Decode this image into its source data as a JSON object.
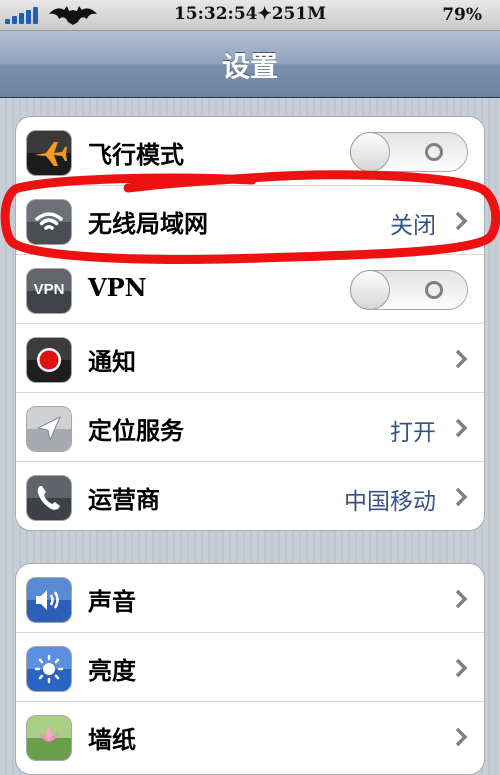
{
  "status_bar": {
    "time": "15:32:54✦251M",
    "battery": "79%"
  },
  "nav": {
    "title": "设置"
  },
  "settings_group_1": [
    {
      "label": "飞行模式",
      "icon": "airplane-icon",
      "control": "toggle",
      "state": "off"
    },
    {
      "label": "无线局域网",
      "icon": "wifi-icon",
      "value": "关闭",
      "control": "chevron"
    },
    {
      "label": "VPN",
      "icon": "vpn-icon",
      "icon_text": "VPN",
      "control": "toggle",
      "state": "off"
    },
    {
      "label": "通知",
      "icon": "notifications-icon",
      "control": "chevron"
    },
    {
      "label": "定位服务",
      "icon": "location-icon",
      "value": "打开",
      "control": "chevron"
    },
    {
      "label": "运营商",
      "icon": "phone-icon",
      "value": "中国移动",
      "control": "chevron"
    }
  ],
  "settings_group_2": [
    {
      "label": "声音",
      "icon": "sound-icon",
      "control": "chevron"
    },
    {
      "label": "亮度",
      "icon": "brightness-icon",
      "control": "chevron"
    },
    {
      "label": "墙纸",
      "icon": "wallpaper-icon",
      "control": "chevron"
    }
  ],
  "colors": {
    "annotation_red": "#ee1111",
    "value_blue": "#385487"
  }
}
